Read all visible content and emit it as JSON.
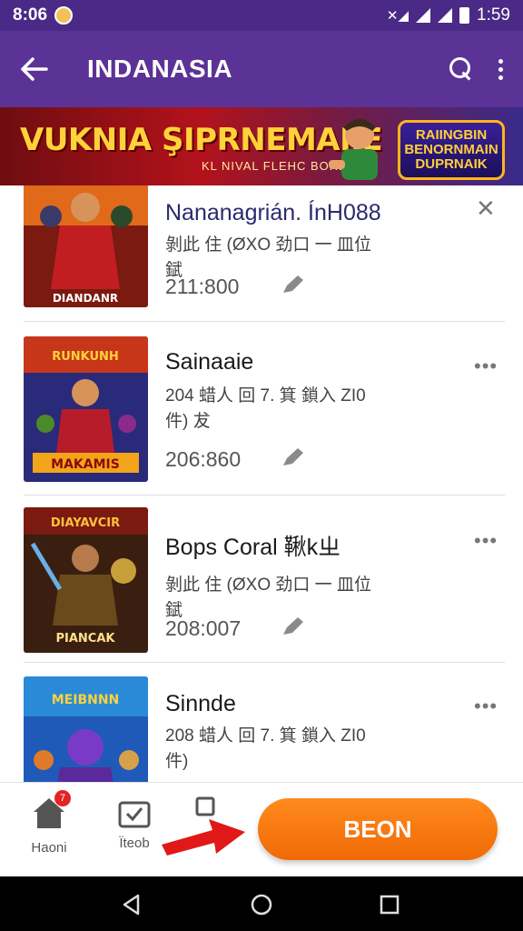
{
  "status_bar": {
    "time_left": "8:06",
    "time_right": "1:59"
  },
  "app_bar": {
    "title": "INDANASIA"
  },
  "banner": {
    "headline": "VUKNIA ŞIPRNEMAIİE",
    "subline": "KL NIVAL FLEHC BORD",
    "logo_lines": [
      "RAIINGBIN",
      "BENORNMAIN",
      "DUPRNAIK"
    ]
  },
  "items": [
    {
      "title": "Nananagrián. ÍnH088",
      "desc": "剝此 住 (ØXO 劲口 一 皿位 錻",
      "count": "211:800",
      "thumb_caption": "DIANDANR",
      "action": "close"
    },
    {
      "title": "Sainaaie",
      "desc": "204 蜡人 回 7. 箕 鎖入 ZI0 件) 犮",
      "count": "206:860",
      "thumb_caption": "MAKAMIS",
      "thumb_top": "RUNKUNH",
      "action": "more"
    },
    {
      "title": "Bops Coral 鞦kㄓ",
      "desc": "剝此 住 (ØXO 劲口 一 皿位 錻",
      "count": "208:007",
      "thumb_caption": "PIANCAK",
      "thumb_top": "DIAYAVCIR",
      "action": "more"
    },
    {
      "title": "Sinnde",
      "desc": "208 蜡人 回 7. 箕 鎖入 ZI0 件)",
      "count": "",
      "thumb_caption": "",
      "thumb_top": "MEIBNNN",
      "action": "more"
    }
  ],
  "bottom_nav": {
    "home_label": "Haoni",
    "home_badge": "7",
    "second_label": "Ïteob",
    "cta_label": "BEON"
  },
  "colors": {
    "app_bar": "#5b3397",
    "status_bar": "#4a2a86",
    "cta": "#f47a12",
    "arrow": "#e01818"
  }
}
